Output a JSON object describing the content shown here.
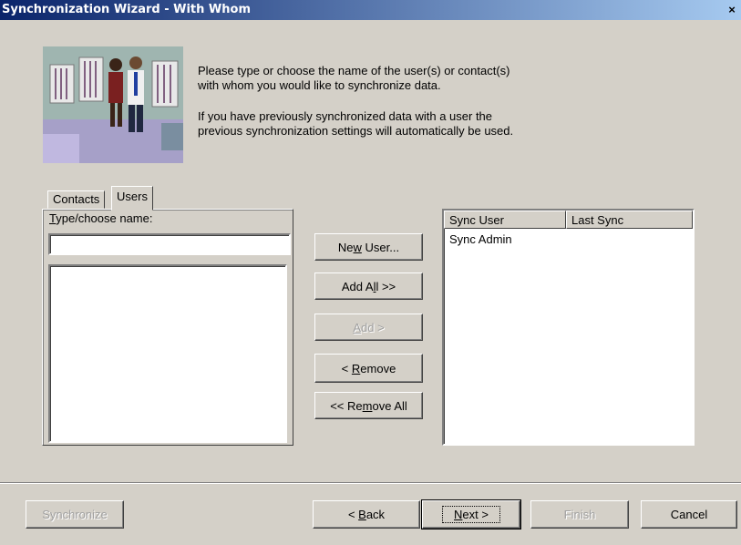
{
  "window": {
    "title": "Synchronization Wizard - With Whom",
    "close_glyph": "×"
  },
  "intro": {
    "line1": "Please type or choose the name of the user(s) or contact(s)",
    "line2": "with whom you would like to synchronize data.",
    "line3": "If you have previously synchronized data with a user the",
    "line4": "previous synchronization settings will automatically be used."
  },
  "tabs": {
    "contacts": "Contacts",
    "users": "Users",
    "active": "Users"
  },
  "name_field": {
    "label_prefix": "T",
    "label_rest": "ype/choose name:",
    "value": ""
  },
  "buttons": {
    "new_user_pre": "Ne",
    "new_user_acc": "w",
    "new_user_post": " User...",
    "add_all_pre": "Add A",
    "add_all_acc": "l",
    "add_all_post": "l >>",
    "add_acc": "A",
    "add_post": "dd >",
    "remove_pre": "< ",
    "remove_acc": "R",
    "remove_post": "emove",
    "remove_all_pre": "<< Re",
    "remove_all_acc": "m",
    "remove_all_post": "ove All"
  },
  "sync_list": {
    "columns": [
      "Sync User",
      "Last Sync"
    ],
    "rows": [
      {
        "user": "Sync Admin",
        "last_sync": ""
      }
    ]
  },
  "footer": {
    "synchronize": "Synchronize",
    "back_pre": "< ",
    "back_acc": "B",
    "back_post": "ack",
    "next_acc": "N",
    "next_post": "ext >",
    "finish": "Finish",
    "cancel": "Cancel"
  },
  "states": {
    "add_enabled": false,
    "synchronize_enabled": false,
    "finish_enabled": false,
    "default_button": "Next"
  }
}
